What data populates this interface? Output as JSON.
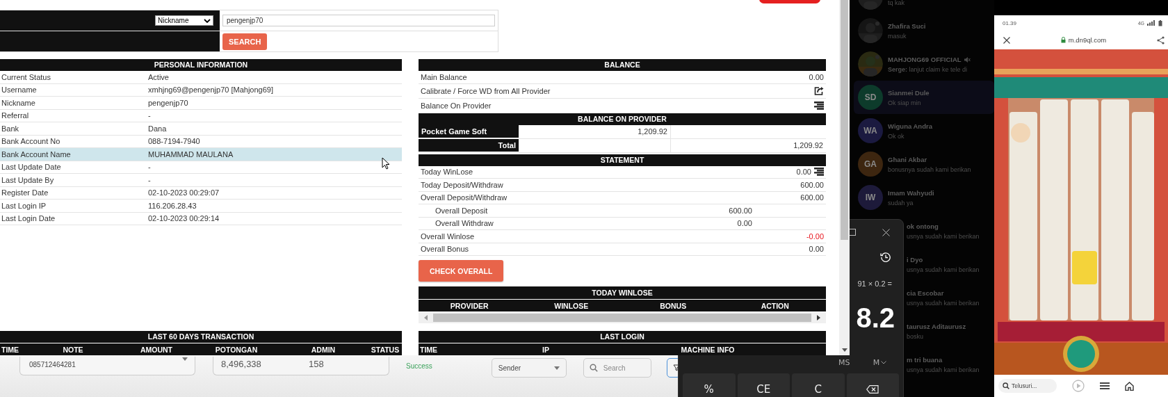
{
  "browser": {
    "search": {
      "option": "Nickname",
      "value": "pengenjp70",
      "button": "SEARCH"
    },
    "personal_information": {
      "title": "PERSONAL INFORMATION",
      "rows": [
        {
          "label": "Current Status",
          "value": "Active",
          "selected": false
        },
        {
          "label": "Username",
          "value": "xmhjng69@pengenjp70  [Mahjong69]",
          "selected": false
        },
        {
          "label": "Nickname",
          "value": "pengenjp70",
          "selected": false
        },
        {
          "label": "Referral",
          "value": "-",
          "selected": false
        },
        {
          "label": "Bank",
          "value": "Dana",
          "selected": false
        },
        {
          "label": "Bank Account No",
          "value": "088-7194-7940",
          "selected": false
        },
        {
          "label": "Bank Account Name",
          "value": "MUHAMMAD MAULANA",
          "selected": true
        },
        {
          "label": "Last Update Date",
          "value": "-",
          "selected": false
        },
        {
          "label": "Last Update By",
          "value": "-",
          "selected": false
        },
        {
          "label": "Register Date",
          "value": "02-10-2023 00:29:07",
          "selected": false
        },
        {
          "label": "Last Login IP",
          "value": "116.206.28.43",
          "selected": false
        },
        {
          "label": "Last Login Date",
          "value": "02-10-2023 00:29:14",
          "selected": false
        }
      ]
    },
    "balance": {
      "title": "BALANCE",
      "rows": [
        {
          "label": "Main Balance",
          "kind": "value",
          "value": "0.00"
        },
        {
          "label": "Calibrate / Force WD from All Provider",
          "kind": "share-icon"
        },
        {
          "label": "Balance On Provider",
          "kind": "list-icon"
        }
      ]
    },
    "balance_on_provider": {
      "title": "BALANCE ON PROVIDER",
      "providers": [
        {
          "name": "Pocket Game Soft",
          "amount": "1,209.92"
        }
      ],
      "total": {
        "label": "Total",
        "amount": "1,209.92"
      }
    },
    "statement": {
      "title": "STATEMENT",
      "rows": [
        {
          "label": "Today WinLose",
          "value": "0.00",
          "kind": "value-list-icon",
          "negative": false
        },
        {
          "label": "Today Deposit/Withdraw",
          "value": "600.00",
          "kind": "value",
          "negative": false
        },
        {
          "label": "Overall Deposit/Withdraw",
          "value": "600.00",
          "kind": "value",
          "negative": false,
          "children": [
            {
              "label": "Overall Deposit",
              "value": "600.00"
            },
            {
              "label": "Overall Withdraw",
              "value": "0.00"
            }
          ]
        },
        {
          "label": "Overall Winlose",
          "value": "-0.00",
          "kind": "value",
          "negative": true
        },
        {
          "label": "Overall Bonus",
          "value": "0.00",
          "kind": "value",
          "negative": false
        }
      ]
    },
    "check_button": "CHECK OVERALL",
    "today_winlose": {
      "title": "TODAY WINLOSE",
      "columns": [
        "PROVIDER",
        "WINLOSE",
        "BONUS",
        "ACTION"
      ]
    },
    "last_60_days_transaction": {
      "title": "LAST 60 DAYS TRANSACTION",
      "columns": [
        "TIME",
        "NOTE",
        "AMOUNT",
        "POTONGAN",
        "ADMIN",
        "STATUS"
      ]
    },
    "last_login": {
      "title": "LAST LOGIN",
      "columns": [
        "TIME",
        "IP",
        "MACHINE INFO"
      ]
    }
  },
  "background_app": {
    "phone_field": "085712464281",
    "amount": "8,496,338",
    "count": "158",
    "status": "Success",
    "sender_select": "Sender",
    "search_placeholder": "Search"
  },
  "chat_list": [
    {
      "kind": "picture-avatar",
      "message": "tq kak",
      "selected": false,
      "muted": false
    },
    {
      "kind": "picture-avatar",
      "name": "Zhafira Suci",
      "message": "masuk",
      "selected": false,
      "muted": false
    },
    {
      "kind": "picture-avatar",
      "name": "MAHJONG69 OFFICIAL",
      "message": "**Serge:** lanjut claim ke tele di",
      "selected": false,
      "muted": true
    },
    {
      "kind": "initials-avatar",
      "initials": "SD",
      "color": "#0d3b2b",
      "name": "Sianmei Dule",
      "message": "Ok siap min",
      "selected": true,
      "muted": false
    },
    {
      "kind": "initials-avatar",
      "initials": "WA",
      "color": "#1b1a40",
      "name": "Wiguna Andra",
      "message": "Ok ok",
      "selected": false,
      "muted": false
    },
    {
      "kind": "initials-avatar",
      "initials": "GA",
      "color": "#3d2610",
      "name": "Ghani Akbar",
      "message": "bonusnya sudah kami berikan",
      "selected": false,
      "muted": false
    },
    {
      "kind": "initials-avatar",
      "initials": "IW",
      "color": "#1d1a3a",
      "name": "Imam Wahyudi",
      "message": "sudah ya",
      "selected": false,
      "muted": false
    },
    {
      "kind": "no-avatar",
      "name": "ok ontong",
      "message": "usnya sudah kami berikan",
      "selected": false,
      "muted": false
    },
    {
      "kind": "no-avatar",
      "name": "i Dyo",
      "message": "usnya sudah kami berikan",
      "selected": false,
      "muted": false
    },
    {
      "kind": "no-avatar",
      "name": "cia Escobar",
      "message": "usnya sudah kami berikan",
      "selected": false,
      "muted": false
    },
    {
      "kind": "no-avatar",
      "name": "taurusz Aditaurusz",
      "message": "bosku",
      "selected": false,
      "muted": false
    },
    {
      "kind": "no-avatar",
      "name": "m tri buana",
      "message": "usnya sudah kami berikan",
      "selected": false,
      "muted": false
    }
  ],
  "calculator": {
    "expression": "91 × 0.2 =",
    "result": "8.2",
    "memory_keys": [
      "MS",
      "M"
    ],
    "keys": [
      {
        "kind": "text",
        "label": "%"
      },
      {
        "kind": "text",
        "label": "CE"
      },
      {
        "kind": "text",
        "label": "C"
      },
      {
        "kind": "backspace"
      }
    ]
  },
  "phone": {
    "time": "01.39",
    "network": "4G",
    "url": "m.dn9ql.com",
    "search_placeholder": "Telusuri..."
  }
}
